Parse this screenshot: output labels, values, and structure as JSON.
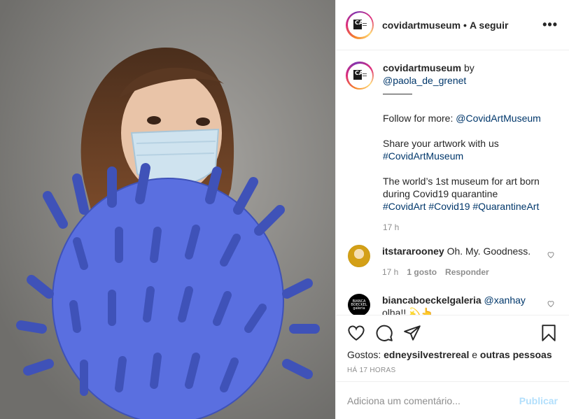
{
  "post": {
    "username": "covidartmuseum",
    "dot": "•",
    "follow_label": "A seguir",
    "more_label": "•••"
  },
  "caption": {
    "username": "covidartmuseum",
    "by": "by",
    "author": "@paola_de_grenet",
    "separator": "———",
    "line1_text": "Follow for more:",
    "line1_link": "@CovidArtMuseum",
    "line2_text": "Share your artwork with us",
    "line2_tag": "#CovidArtMuseum",
    "line3_text": "The world’s 1st museum for art born during Covid19 quarantine",
    "line3_tags": "#CovidArt #Covid19 #QuarantineArt",
    "time": "17 h"
  },
  "comments": [
    {
      "username": "itstararooney",
      "text": "Oh. My. Goodness.",
      "time": "17 h",
      "likes": "1 gosto",
      "reply": "Responder"
    },
    {
      "username": "biancaboeckelgaleria",
      "mention": "@xanhay",
      "text": "olha!! 💫👆",
      "avatar_text": [
        "BIANCA",
        "BOECKEL",
        "galeria"
      ]
    }
  ],
  "likes": {
    "label": "Gostos:",
    "user": "edneysilvestrereal",
    "and": "e",
    "others": "outras pessoas"
  },
  "timestamp": "HÁ 17 HORAS",
  "comment_box": {
    "placeholder": "Adiciona um comentário...",
    "publish": "Publicar"
  },
  "icons": [
    "heart-icon",
    "comment-icon",
    "share-icon",
    "save-icon",
    "more-icon"
  ],
  "colors": {
    "link": "#00376b",
    "muted": "#8e8e8e",
    "publish_disabled": "#b2dffc",
    "gloves": "#5a6fe0"
  }
}
